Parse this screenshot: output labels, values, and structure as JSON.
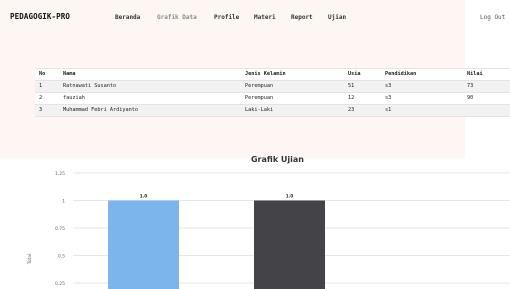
{
  "navbar": {
    "brand": "PEDAGOGIK-PRO",
    "links": [
      "Beranda",
      "Grafik Data",
      "Profile",
      "Materi",
      "Report",
      "Ujian"
    ],
    "logout": "Log Out"
  },
  "table": {
    "headers": [
      "No",
      "Nama",
      "Jenis Kelamin",
      "Usia",
      "Pendidikan",
      "Nilai"
    ],
    "rows": [
      [
        "1",
        "Ratnawati Susanto",
        "Perempuan",
        "51",
        "s3",
        "73"
      ],
      [
        "2",
        "fauziah",
        "Perempuan",
        "12",
        "s3",
        "90"
      ],
      [
        "3",
        "Muhammad Febri Ardiyanto",
        "Laki-Laki",
        "23",
        "s1",
        ""
      ]
    ]
  },
  "chart_data": {
    "type": "bar",
    "title": "Grafik Ujian",
    "ylabel": "Total",
    "ylim": [
      0,
      1.25
    ],
    "yticks": [
      "0.25",
      "0.5",
      "0.75",
      "1",
      "1.25"
    ],
    "values": [
      1.0,
      1.0
    ],
    "data_labels": [
      "1.0",
      "1.0"
    ],
    "colors": [
      "#7cb5ec",
      "#434348"
    ],
    "grid": true
  }
}
